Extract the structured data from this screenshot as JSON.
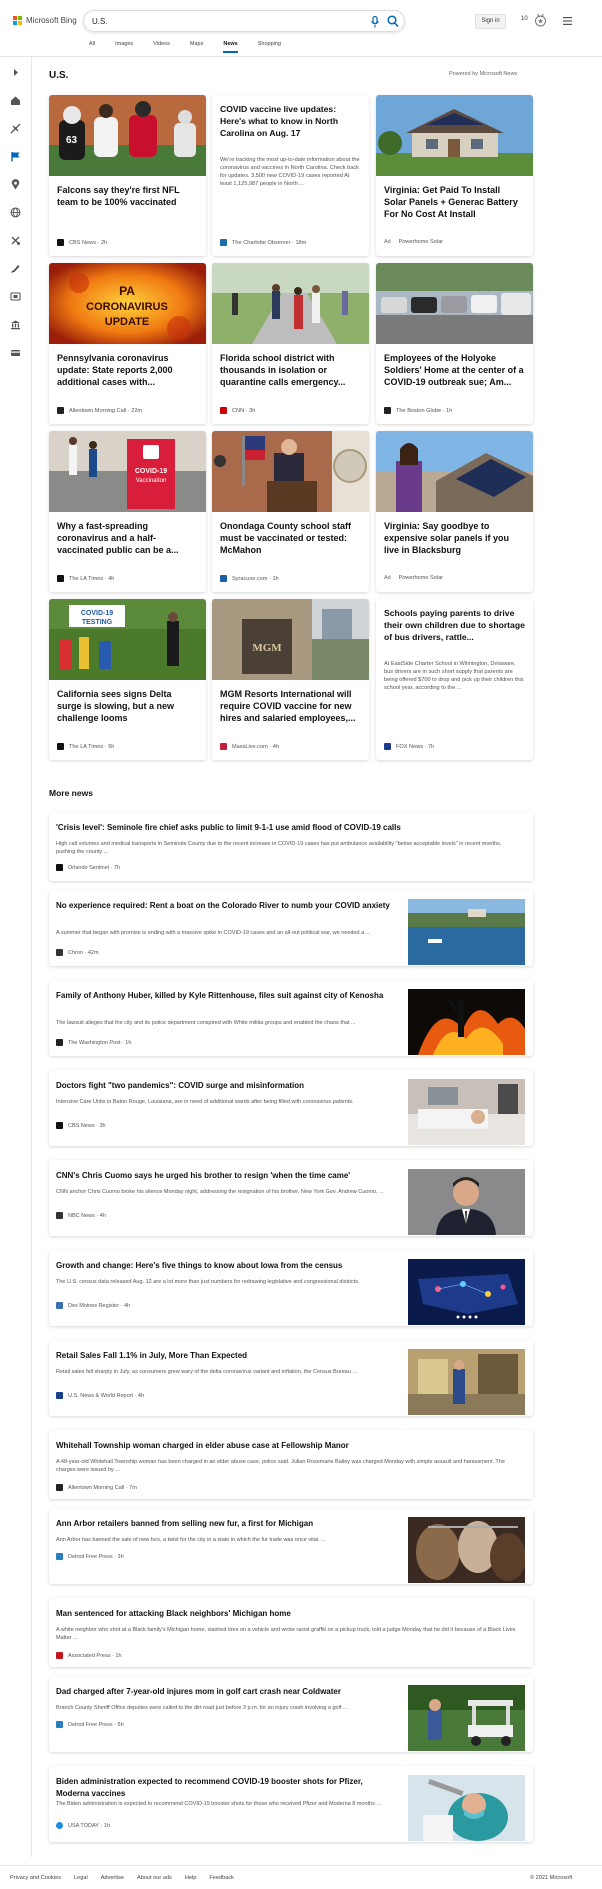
{
  "header": {
    "brand": "Microsoft Bing",
    "search_value": "U.S.",
    "sign_in": "Sign in",
    "rewards_count": "10",
    "tabs": [
      "All",
      "Images",
      "Videos",
      "Maps",
      "News",
      "Shopping"
    ],
    "active_tab": "News"
  },
  "sidebar": {
    "icons": [
      "expand-icon",
      "home-icon",
      "local-icon",
      "flag-icon",
      "location-icon",
      "globe-icon",
      "sports-icon",
      "science-tech-icon",
      "entertainment-icon",
      "politics-icon",
      "money-icon"
    ]
  },
  "main": {
    "title": "U.S.",
    "powered_by": "Powered by Microsoft News",
    "cards": [
      {
        "title": "Falcons say they're first NFL team to be 100% vaccinated",
        "source": "CBS News",
        "time": "2h",
        "fav_color": "#111111"
      },
      {
        "title": "COVID vaccine live updates: Here's what to know in North Carolina on Aug. 17",
        "snippet": "We're tracking the most up-to-date information about the coronavirus and vaccines in North Carolina. Check back for updates. 3,500 new COVID-19 cases reported At least 1,125,987 people in North ...",
        "source": "The Charlotte Observer",
        "time": "18m",
        "fav_color": "#1b6fa8"
      },
      {
        "title": "Virginia: Get Paid To Install Solar Panels + Generac Battery For No Cost At Install",
        "ad": "Ad",
        "source": "Powerhome Solar",
        "time": "",
        "fav_color": ""
      },
      {
        "title": "Pennsylvania coronavirus update: State reports 2,000 additional cases with...",
        "source": "Allentown Morning Call",
        "time": "22m",
        "fav_color": "#222222"
      },
      {
        "title": "Florida school district with thousands in isolation or quarantine calls emergency...",
        "source": "CNN",
        "time": "3h",
        "fav_color": "#cc0000"
      },
      {
        "title": "Employees of the Holyoke Soldiers' Home at the center of a COVID-19 outbreak sue; Am...",
        "source": "The Boston Globe",
        "time": "1h",
        "fav_color": "#222222"
      },
      {
        "title": "Why a fast-spreading coronavirus and a half-vaccinated public can be a...",
        "source": "The LA Times",
        "time": "4h",
        "fav_color": "#111111"
      },
      {
        "title": "Onondaga County school staff must be vaccinated or tested: McMahon",
        "source": "Syracuse.com",
        "time": "1h",
        "fav_color": "#1a5fa0"
      },
      {
        "title": "Virginia: Say goodbye to expensive solar panels if you live in Blacksburg",
        "ad": "Ad",
        "source": "Powerhome Solar",
        "time": "",
        "fav_color": ""
      },
      {
        "title": "California sees signs Delta surge is slowing, but a new challenge looms",
        "source": "The LA Times",
        "time": "5h",
        "fav_color": "#111111"
      },
      {
        "title": "MGM Resorts International will require COVID vaccine for new hires and salaried employees,...",
        "source": "MassLive.com",
        "time": "4h",
        "fav_color": "#c0203a"
      },
      {
        "title": "Schools paying parents to drive their own children due to shortage of bus drivers, rattle...",
        "snippet": "At EastSide Charter School in Wilmington, Delaware, bus drivers are in such short supply that parents are being offered $700 to drop and pick up their children this school year, according to the ...",
        "source": "FOX News",
        "time": "7h",
        "fav_color": "#1b3a8a"
      }
    ],
    "image_texts": {
      "pa_update": "PA CORONAVIRUS UPDATE",
      "covid_sign": "COVID-19 Vaccination",
      "covid_testing": "COVID-19 TESTING",
      "mgm": "MGM"
    }
  },
  "more": {
    "title": "More news",
    "items": [
      {
        "title": "'Crisis level': Seminole fire chief asks public to limit 9-1-1 use amid flood of COVID-19 calls",
        "snippet": "High call volumes and medical transports in Seminole County due to the recent increase in COVID-19 cases has put ambulance availability \"below acceptable levels\" in recent months, pushing the county ...",
        "source": "Orlando Sentinel",
        "time": "7h",
        "fav_color": "#111111"
      },
      {
        "title": "No experience required: Rent a boat on the Colorado River to numb your COVID anxiety",
        "snippet": "A summer that began with promise is ending with a massive spike in COVID-19 cases and an all-out political war, we needed a ...",
        "source": "Chron",
        "time": "42m",
        "fav_color": "#333333"
      },
      {
        "title": "Family of Anthony Huber, killed by Kyle Rittenhouse, files suit against city of Kenosha",
        "snippet": "The lawsuit alleges that the city and its police department conspired with White militia groups and enabled the chaos that ...",
        "source": "The Washington Post",
        "time": "1h",
        "fav_color": "#222222"
      },
      {
        "title": "Doctors fight \"two pandemics\": COVID surge and misinformation",
        "snippet": "Intensive Care Units in Baton Rouge, Louisiana, are in need of additional wards after being filled with coronavirus patients.",
        "source": "CBS News",
        "time": "3h",
        "fav_color": "#111111"
      },
      {
        "title": "CNN's Chris Cuomo says he urged his brother to resign 'when the time came'",
        "snippet": "CNN anchor Chris Cuomo broke his silence Monday night, addressing the resignation of his brother, New York Gov. Andrew Cuomo, ...",
        "source": "NBC News",
        "time": "4h",
        "fav_color": "#333333"
      },
      {
        "title": "Growth and change: Here's five things to know about Iowa from the census",
        "snippet": "The U.S. census data released Aug. 12 are a lot more than just numbers for redrawing legislative and congressional districts.",
        "source": "Des Moines Register",
        "time": "4h",
        "fav_color": "#3a6fb0"
      },
      {
        "title": "Retail Sales Fall 1.1% in July, More Than Expected",
        "snippet": "Retail sales fell sharply in July, as consumers grew wary of the delta coronavirus variant and inflation, the Census Bureau ...",
        "source": "U.S. News & World Report",
        "time": "4h",
        "fav_color": "#1a3f8f"
      },
      {
        "title": "Whitehall Township woman charged in elder abuse case at Fellowship Manor",
        "snippet": "A 48-year-old Whitehall Township woman has been charged in an elder abuse case, police said. Julian Rosemarie Bailey was charged Monday with simple assault and harassment. The charges were issued by ...",
        "source": "Allentown Morning Call",
        "time": "7m",
        "fav_color": "#222222"
      },
      {
        "title": "Ann Arbor retailers banned from selling new fur, a first for Michigan",
        "snippet": "Ann Arbor has banned the sale of new furs, a twist for the city in a state in which the fur trade was once vital. ...",
        "source": "Detroit Free Press",
        "time": "3h",
        "fav_color": "#2a7fc1"
      },
      {
        "title": "Man sentenced for attacking Black neighbors' Michigan home",
        "snippet": "A white neighbor who shot at a Black family's Michigan home, slashed tires on a vehicle and wrote racist graffiti on a pickup truck, told a judge Monday that he did it because of a Black Lives Matter ...",
        "source": "Associated Press",
        "time": "1h",
        "fav_color": "#c4161c"
      },
      {
        "title": "Dad charged after 7-year-old injures mom in golf cart crash near Coldwater",
        "snippet": "Branch County Sheriff Office deputies were called to the dirt road just before 3 p.m. for an injury crash involving a golf ...",
        "source": "Detroit Free Press",
        "time": "5h",
        "fav_color": "#2a7fc1"
      },
      {
        "title": "Biden administration expected to recommend COVID-19 booster shots for Pfizer, Moderna vaccines",
        "snippet": "The Biden administration is expected to recommend COVID-19 booster shots for those who received Pfizer and Moderna 8 months ...",
        "source": "USA TODAY",
        "time": "1h",
        "fav_color": "#1f8ad9"
      }
    ]
  },
  "footer": {
    "links": [
      "Privacy and Cookies",
      "Legal",
      "Advertise",
      "About our ads",
      "Help",
      "Feedback"
    ],
    "copyright": "© 2021 Microsoft"
  }
}
